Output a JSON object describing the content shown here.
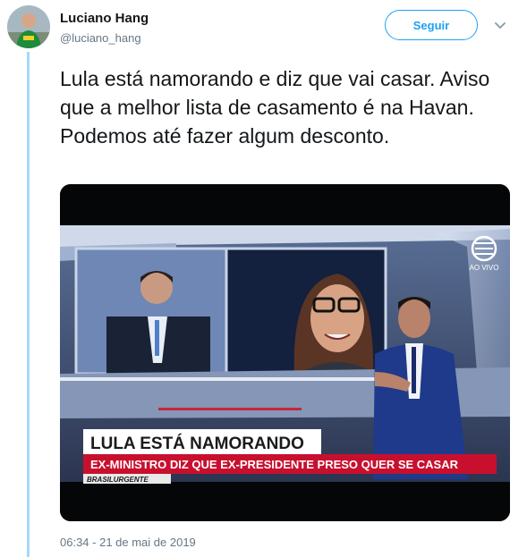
{
  "tweet": {
    "author_name": "Luciano Hang",
    "author_handle": "@luciano_hang",
    "follow_label": "Seguir",
    "text": "Lula está namorando e diz que vai casar. Aviso que a melhor lista de casamento é na Havan. Podemos até fazer algum desconto.",
    "timestamp": "06:34 - 21 de mai de 2019"
  },
  "media": {
    "headline": "LULA ESTÁ NAMORANDO",
    "subheadline": "EX-MINISTRO DIZ QUE EX-PRESIDENTE PRESO QUER SE CASAR",
    "program_tag": "BRASILURGENTE",
    "live_label": "AO VIVO"
  },
  "colors": {
    "accent": "#1da1f2",
    "thread": "#a5d8f5",
    "muted": "#657786"
  },
  "icons": {
    "menu": "chevron-down-icon",
    "channel": "band-logo-icon"
  }
}
